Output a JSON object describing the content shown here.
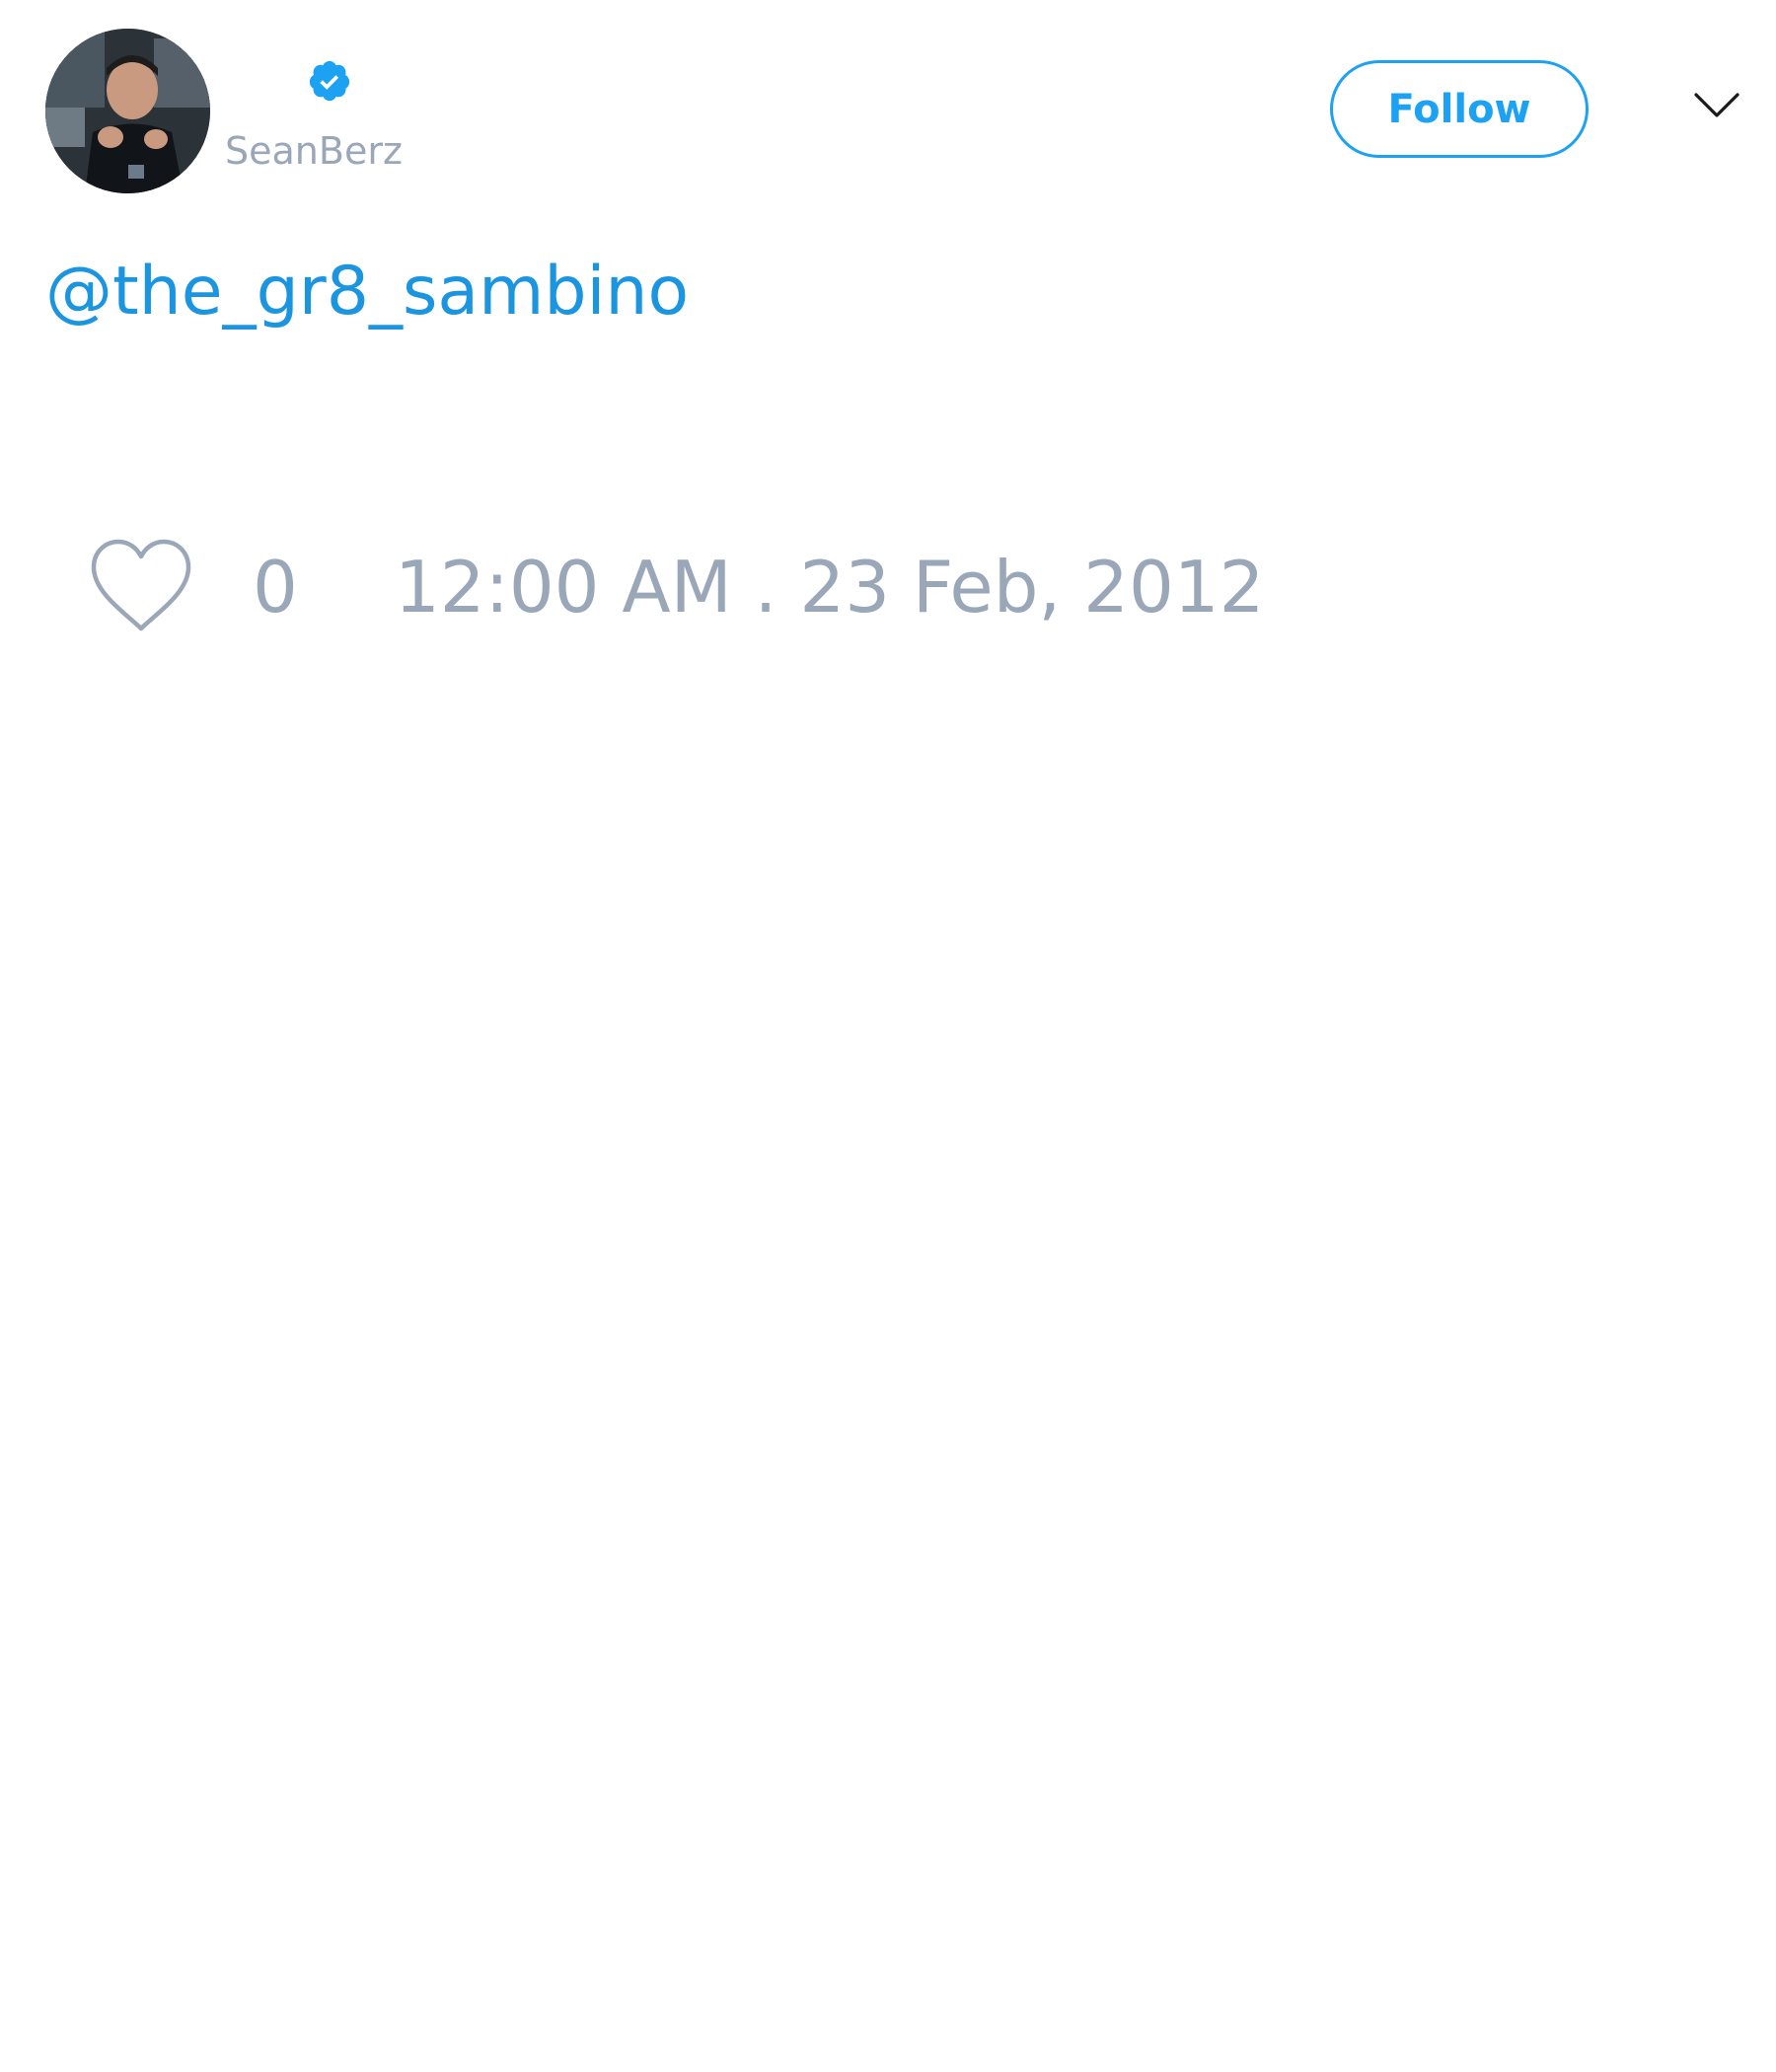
{
  "author": {
    "username": "SeanBerz",
    "display_name": "",
    "verified": true,
    "avatar_icon": "profile-photo"
  },
  "header": {
    "follow_label": "Follow",
    "menu_icon": "chevron-down-icon"
  },
  "tweet": {
    "text": "@the_gr8_sambino"
  },
  "footer": {
    "like_icon": "heart-outline-icon",
    "like_count": "0",
    "timestamp": "12:00 AM . 23 Feb, 2012"
  },
  "colors": {
    "accent": "#1da1f2",
    "link": "#1b95e0",
    "muted": "#9aa7b8"
  }
}
